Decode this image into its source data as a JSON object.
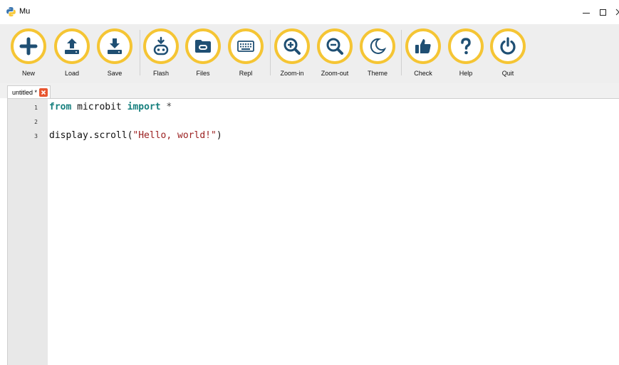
{
  "window": {
    "title": "Mu"
  },
  "toolbar": {
    "buttons": [
      {
        "id": "new",
        "label": "New",
        "icon": "plus-icon"
      },
      {
        "id": "load",
        "label": "Load",
        "icon": "upload-icon"
      },
      {
        "id": "save",
        "label": "Save",
        "icon": "download-icon"
      },
      {
        "id": "flash",
        "label": "Flash",
        "icon": "microbit-flash-icon"
      },
      {
        "id": "files",
        "label": "Files",
        "icon": "folder-icon"
      },
      {
        "id": "repl",
        "label": "Repl",
        "icon": "keyboard-icon"
      },
      {
        "id": "zoom_in",
        "label": "Zoom-in",
        "icon": "zoom-in-icon"
      },
      {
        "id": "zoom_out",
        "label": "Zoom-out",
        "icon": "zoom-out-icon"
      },
      {
        "id": "theme",
        "label": "Theme",
        "icon": "moon-icon"
      },
      {
        "id": "check",
        "label": "Check",
        "icon": "thumbs-up-icon"
      },
      {
        "id": "help",
        "label": "Help",
        "icon": "question-icon"
      },
      {
        "id": "quit",
        "label": "Quit",
        "icon": "power-icon"
      }
    ]
  },
  "tabs": [
    {
      "label": "untitled *"
    }
  ],
  "editor": {
    "line_numbers": [
      "1",
      "2",
      "3"
    ],
    "lines": [
      {
        "kw1": "from",
        "mid": " microbit ",
        "kw2": "import",
        "rest": " *"
      },
      {
        "text": ""
      },
      {
        "prefix": "display.scroll(",
        "string": "\"Hello, world!\"",
        "suffix": ")"
      }
    ]
  },
  "colors": {
    "accent_ring": "#f5c534",
    "icon_dark": "#1f4f73",
    "keyword": "#17807e",
    "string": "#9b2020",
    "tab_close": "#e8552f"
  }
}
